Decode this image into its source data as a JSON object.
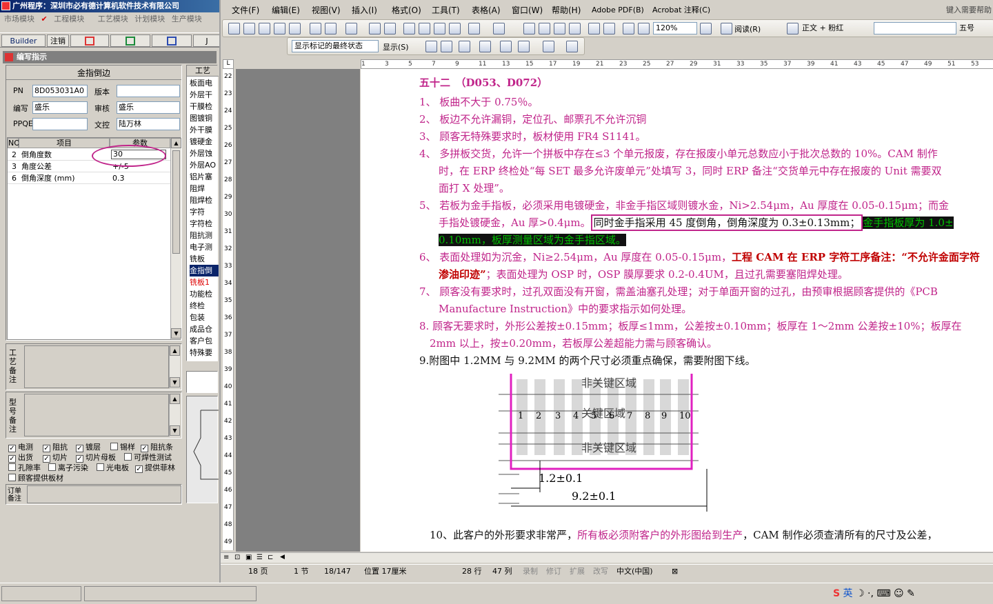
{
  "left": {
    "title": "广州程序：深圳市必有德计算机软件技术有限公司",
    "menu": [
      "市场模块",
      "工程模块",
      "工艺模块",
      "计划模块",
      "生产模块"
    ],
    "toolbar": {
      "builder": "Builder",
      "cancel": "注销"
    },
    "window_caption": "编写指示",
    "section_title": "金指倒边",
    "fields": {
      "pn_label": "PN",
      "pn_value": "8D053031A0",
      "version_label": "版本",
      "version_value": "",
      "writer_label": "编写",
      "writer_value": "盛乐",
      "reviewer_label": "审核",
      "reviewer_value": "盛乐",
      "ppqe_label": "PPQE",
      "ppqe_value": "",
      "docctl_label": "文控",
      "docctl_value": "陆万林"
    },
    "grid": {
      "headers": [
        "NO",
        "项目",
        "参数"
      ],
      "rows": [
        {
          "no": "2",
          "item": "倒角度数",
          "param": "30"
        },
        {
          "no": "3",
          "item": "角度公差",
          "param": "+/-5"
        },
        {
          "no": "6",
          "item": "倒角深度 (mm)",
          "param": "0.3"
        }
      ]
    },
    "process_header": "工艺",
    "processes": [
      "板面电",
      "外层干",
      "干膜检",
      "图镀铜",
      "外干膜",
      "镀硬金",
      "外层蚀",
      "外层AO",
      "铝片塞",
      "阻焊",
      "阻焊检",
      "字符",
      "字符检",
      "阻抗测",
      "电子测",
      "铣板",
      "金指倒",
      "铣板1",
      "功能检",
      "终检",
      "包装",
      "成品仓",
      "客户包",
      "特殊要"
    ],
    "remark_labels": {
      "process": "工艺备注",
      "model": "型号备注",
      "order": "订单备注"
    },
    "checks": [
      {
        "label": "电测",
        "checked": true
      },
      {
        "label": "阻抗",
        "checked": true
      },
      {
        "label": "镀层",
        "checked": true
      },
      {
        "label": "锡样",
        "checked": false
      },
      {
        "label": "阻抗条",
        "checked": true
      },
      {
        "label": "出货",
        "checked": true
      },
      {
        "label": "切片",
        "checked": true
      },
      {
        "label": "切片母板",
        "checked": true
      },
      {
        "label": "可焊性测试",
        "checked": false
      },
      {
        "label": "孔隙率",
        "checked": false
      },
      {
        "label": "离子污染",
        "checked": false
      },
      {
        "label": "光电板",
        "checked": false
      },
      {
        "label": "提供菲林",
        "checked": true
      },
      {
        "label": "顾客提供板材",
        "checked": false
      }
    ]
  },
  "word": {
    "menu": [
      "文件(F)",
      "编辑(E)",
      "视图(V)",
      "插入(I)",
      "格式(O)",
      "工具(T)",
      "表格(A)",
      "窗口(W)",
      "帮助(H)",
      "Adobe PDF(B)",
      "Acrobat 注释(C)"
    ],
    "help_placeholder": "键入需要帮助",
    "zoom": "120%",
    "read_label": "阅读(R)",
    "style": "正文 + 粉红",
    "font_size": "五号",
    "markup_view": "显示标记的最终状态",
    "show_label": "显示(S)",
    "lines": {
      "title": "五十二　（D053、D072）",
      "l1": "1、 板曲不大于 0.75％。",
      "l2": "2、 板边不允许漏铜，定位孔、邮票孔不允许沉铜",
      "l3": "3、 顾客无特殊要求时，板材使用 FR4 S1141。",
      "l4a": "4、 多拼板交货，允许一个拼板中存在≤3 个单元报废，存在报废小单元总数应小于批次总数的 10%。CAM 制作",
      "l4b": "时，在 ERP 终检处“每 SET 最多允许废单元”处填写 3，同时 ERP 备注“交货单元中存在报废的 Unit 需要双",
      "l4c": "面打 X 处理”。",
      "l5a": "5、 若板为金手指板，必须采用电镀硬金，非金手指区域则镀水金，Ni>2.54μm，Au 厚度在 0.05-0.15μm；而金",
      "l5b_pre": "手指处镀硬金，Au 厚>0.4μm。",
      "l5b_box": "同时金手指采用 45 度倒角，倒角深度为 0.3±0.13mm；",
      "l5b_hl": "金手指板厚为 1.0±",
      "l5c": "0.10mm，板厚测量区域为金手指区域。",
      "l6a_pre": "6、 表面处理如为沉金，Ni≥2.54μm，Au 厚度在 0.05-0.15μm，",
      "l6a_red": "工程 CAM 在 ERP 字符工序备注：“不允许金面字符",
      "l6b_red": "渗油印迹”",
      "l6b_post": "；表面处理为 OSP 时，OSP 膜厚要求 0.2-0.4UM，且过孔需要塞阻焊处理。",
      "l7a": "7、 顾客没有要求时，过孔双面没有开窗，需盖油塞孔处理；对于单面开窗的过孔，由预审根据顾客提供的《PCB",
      "l7b": "Manufacture Instruction》中的要求指示如何处理。",
      "l8a": "8. 顾客无要求时，外形公差按±0.15mm；板厚≤1mm，公差按±0.10mm；板厚在 1～2mm 公差按±10%；板厚在",
      "l8b": "2mm 以上，按±0.20mm，若板厚公差超能力需与顾客确认。",
      "l9": "9.附图中 1.2MM 与 9.2MM 的两个尺寸必须重点确保，需要附图下线。",
      "l10_pre": "10、此客户的外形要求非常严，",
      "l10_pink": "所有板必须附客户的外形图给到生产",
      "l10_post": "，CAM 制作必须查清所有的尺寸及公差，"
    },
    "figure": {
      "top_label": "非关键区域",
      "mid_label": "关键区域",
      "bottom_label": "非关键区域",
      "fingers": [
        "1",
        "2",
        "3",
        "4",
        "5",
        "6",
        "7",
        "8",
        "9",
        "10"
      ],
      "dim1": "1.2±0.1",
      "dim2": "9.2±0.1"
    },
    "status": {
      "page": "18 页",
      "section": "1 节",
      "pages": "18/147",
      "pos": "位置 17厘米",
      "line": "28 行",
      "col": "47 列",
      "rec": "录制",
      "rev": "修订",
      "ext": "扩展",
      "ovr": "改写",
      "lang": "中文(中国)"
    }
  },
  "taskbar": {
    "ime": "英"
  }
}
